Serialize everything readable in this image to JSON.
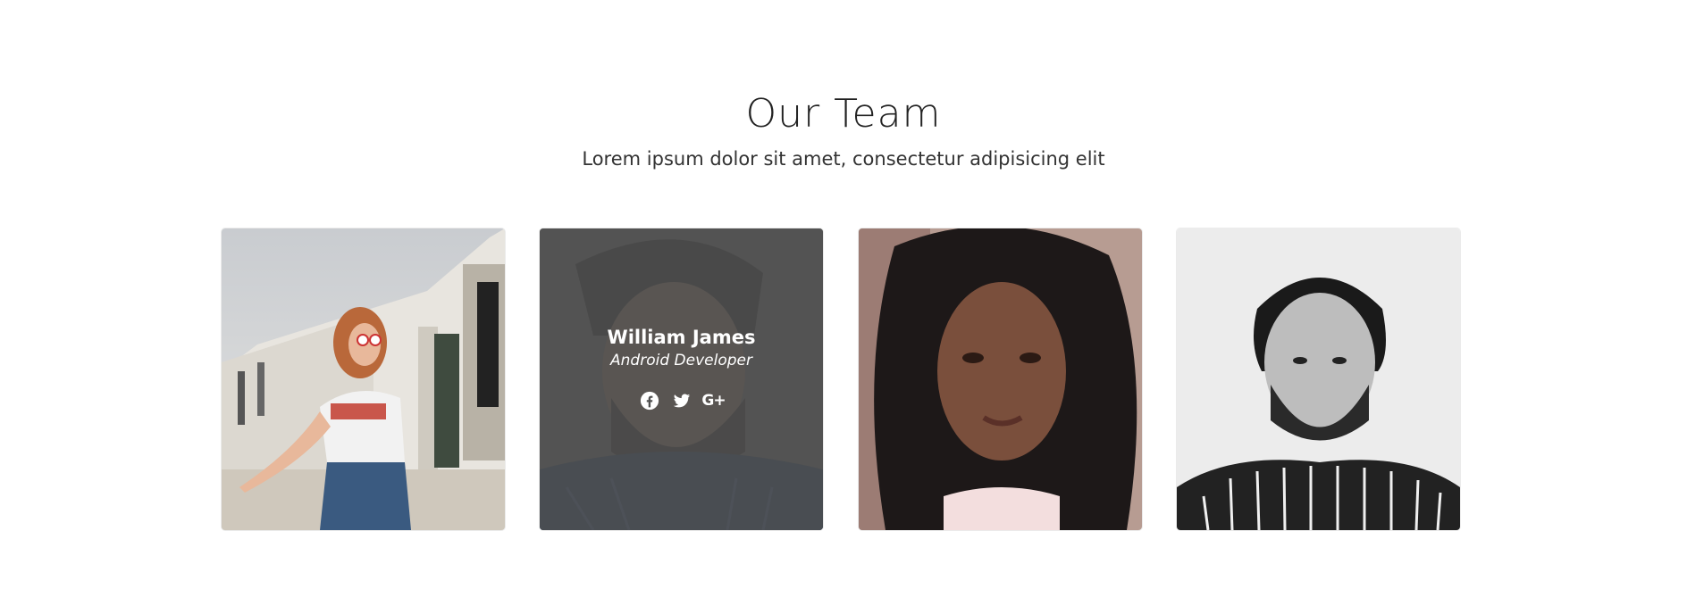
{
  "team": {
    "title": "Our Team",
    "subtitle": "Lorem ipsum dolor sit amet, consectetur adipisicing elit",
    "members": [
      {
        "photo": "woman-red-hair-sunglasses"
      },
      {
        "photo": "man-beard-blue-shirt",
        "name": "William James",
        "role": "Android Developer",
        "socials": [
          "facebook-icon",
          "twitter-icon",
          "google-plus-icon"
        ],
        "google_plus_label": "G+"
      },
      {
        "photo": "woman-curly-hair"
      },
      {
        "photo": "man-beard-striped-shirt"
      }
    ]
  },
  "colors": {
    "overlay": "#505050",
    "text": "#222222",
    "background": "#ffffff"
  }
}
